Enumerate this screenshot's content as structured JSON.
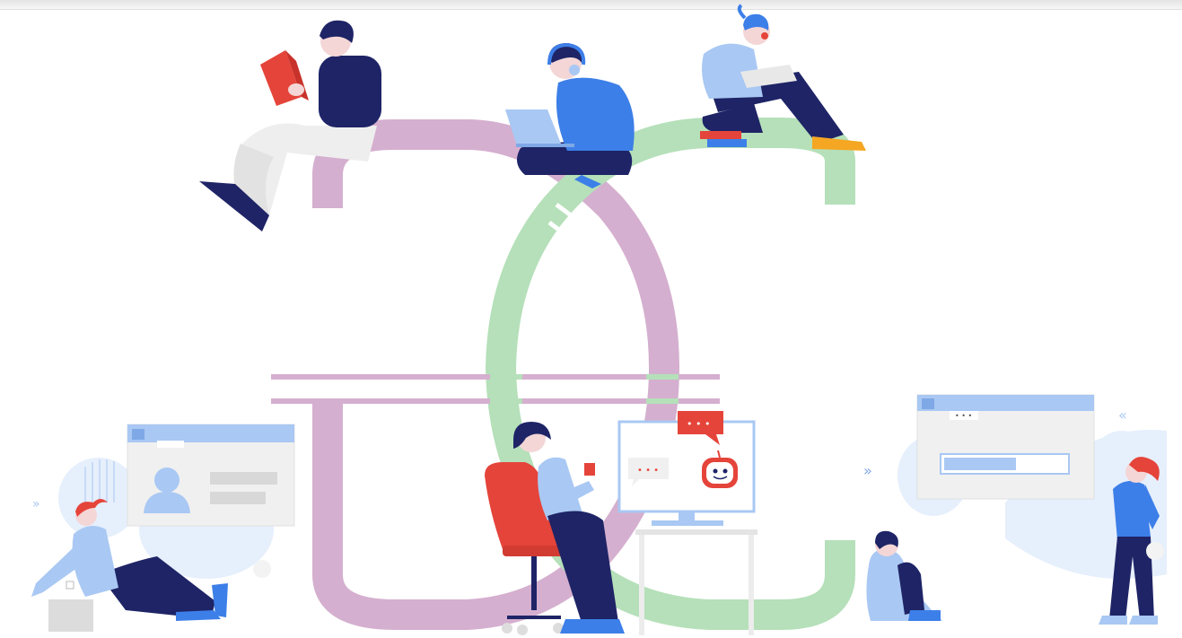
{
  "illustration": {
    "colors": {
      "background": "#ffffff",
      "loop_pink": "#d5afcf",
      "loop_green": "#b5e0b9",
      "navy": "#1e2466",
      "blue": "#3d7fe8",
      "light_blue": "#a9c8f3",
      "pale_blue": "#e6effc",
      "red": "#e5443a",
      "orange": "#f5a623",
      "skin": "#f4d6d6",
      "panel_grey": "#f0f0f0"
    },
    "chat_bubble_text": "• • •",
    "chevron_right": "»",
    "chevron_left": "«"
  }
}
